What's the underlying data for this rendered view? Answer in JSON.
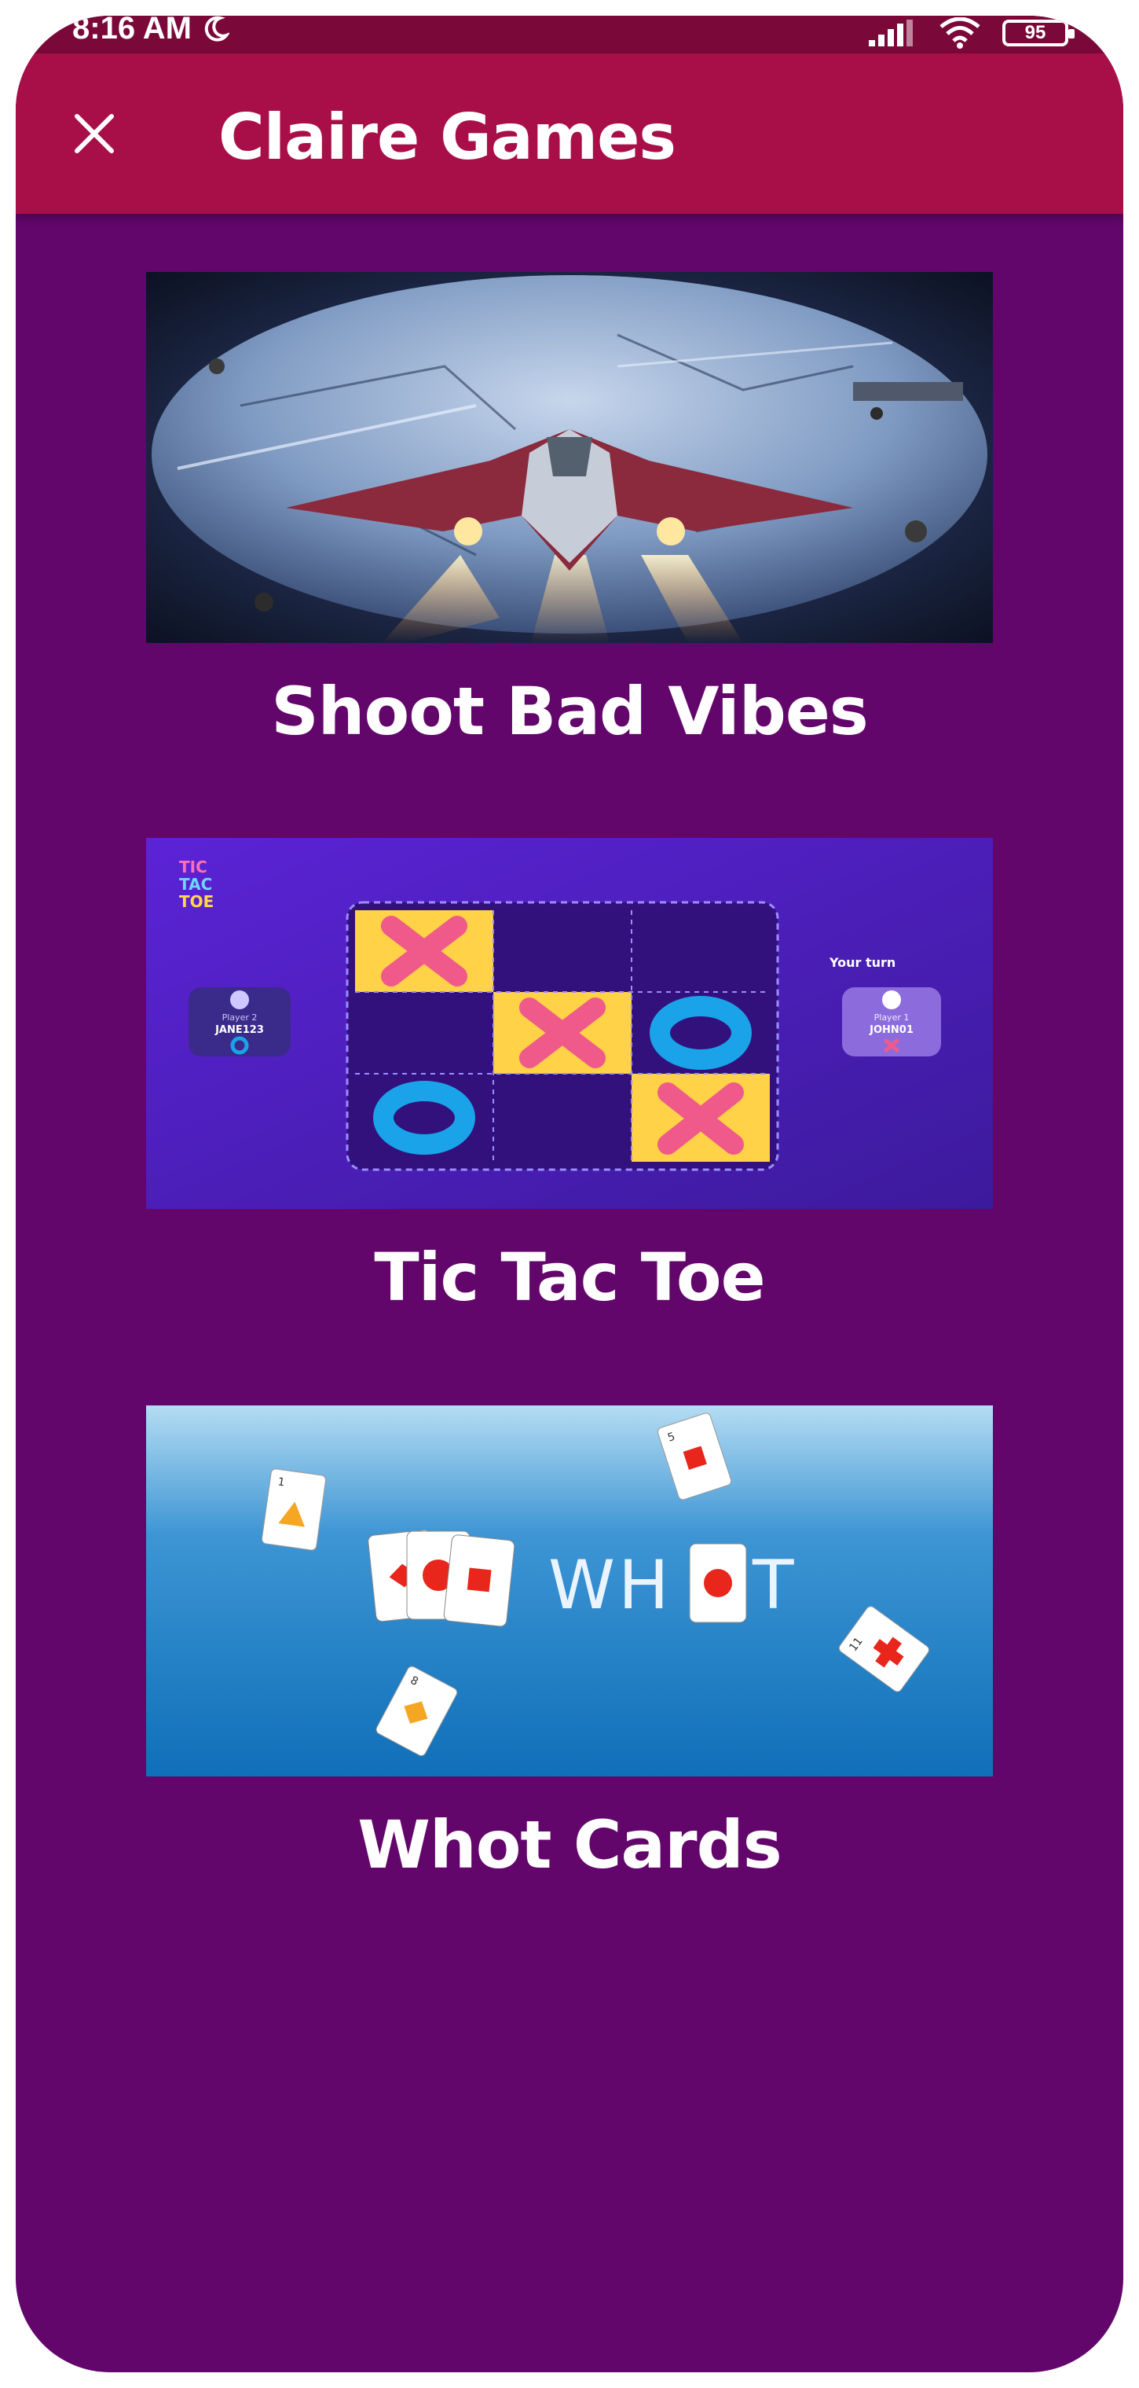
{
  "status_bar": {
    "time": "8:16 AM",
    "battery": "95",
    "icons": [
      "moon-icon",
      "signal-icon",
      "wifi-icon",
      "battery-icon"
    ]
  },
  "app_bar": {
    "title": "Claire Games",
    "close_icon": "close-icon"
  },
  "colors": {
    "status_bar": "#7a0838",
    "app_bar": "#a80f48",
    "background": "#63066b",
    "text": "#ffffff"
  },
  "games": [
    {
      "title": "Shoot Bad Vibes"
    },
    {
      "title": "Tic Tac Toe",
      "thumbnail_text": {
        "logo": [
          "TIC",
          "TAC",
          "TOE"
        ],
        "your_turn": "Your turn",
        "player_left_label": "Player 2",
        "player_left_name": "JANE123",
        "player_right_label": "Player 1",
        "player_right_name": "JOHN01"
      }
    },
    {
      "title": "Whot Cards",
      "thumbnail_text": {
        "logo": "WH",
        "logo_end": "T",
        "card_numbers": [
          "1",
          "5",
          "8",
          "11"
        ]
      }
    }
  ]
}
